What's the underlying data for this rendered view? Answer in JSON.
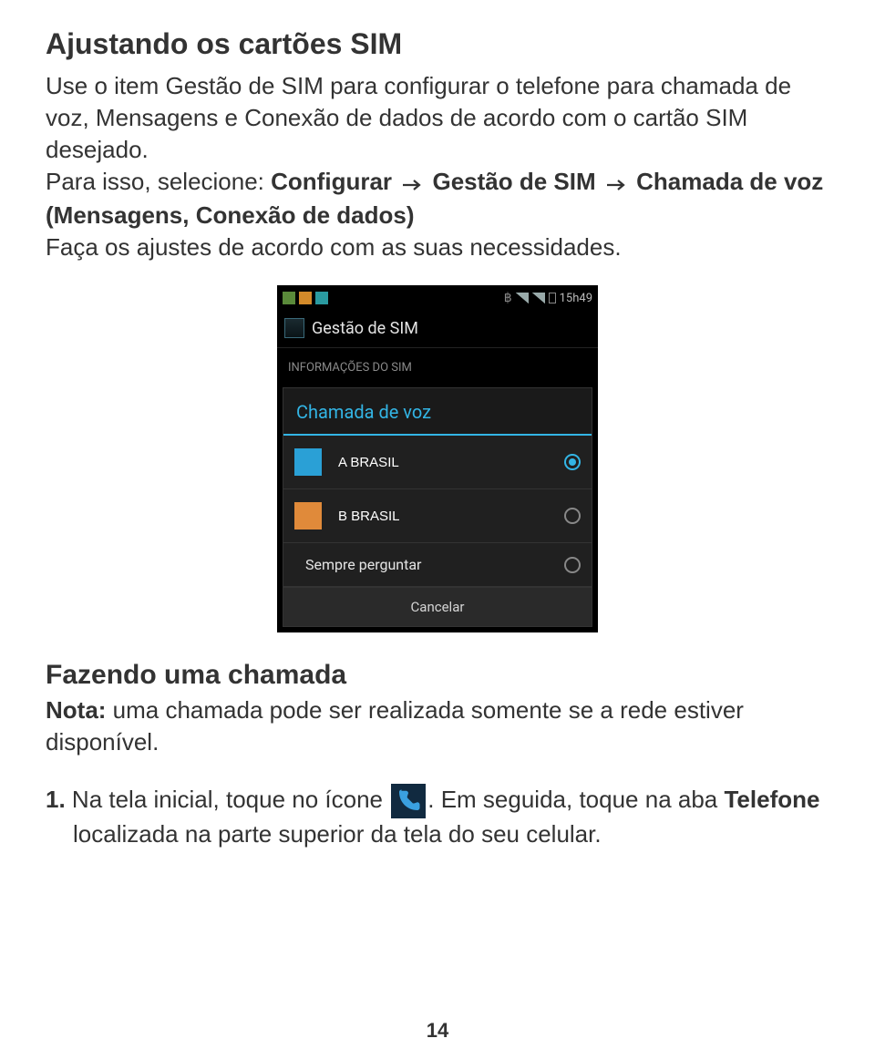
{
  "page_number": "14",
  "section1": {
    "title": "Ajustando os cartões SIM",
    "p1_a": "Use o item Gestão de SIM para configurar o telefone para chamada de voz, Mensagens e Conexão de dados de acordo com o cartão SIM desejado.",
    "p2_a": "Para isso, selecione: ",
    "p2_b": "Configurar",
    "p2_c": "Gestão de SIM",
    "p2_d": "Chamada de voz (Mensagens, Conexão de dados)",
    "p3": "Faça os ajustes de acordo com as suas necessidades."
  },
  "phone": {
    "status_time": "15h49",
    "app_title": "Gestão de SIM",
    "section_label": "INFORMAÇÕES DO SIM",
    "dialog_title": "Chamada de voz",
    "rows": [
      {
        "label": "A BRASIL",
        "square_class": "blue",
        "selected": true
      },
      {
        "label": "B BRASIL",
        "square_class": "orange",
        "selected": false
      },
      {
        "label": "Sempre perguntar",
        "square_class": "",
        "selected": false
      }
    ],
    "cancel": "Cancelar"
  },
  "section2": {
    "title": "Fazendo uma chamada",
    "note_label": "Nota:",
    "note_body": " uma chamada pode ser realizada somente se a rede estiver disponível.",
    "step1_num": "1.",
    "step1_a": " Na tela inicial, toque no ícone ",
    "step1_b": ". Em seguida, toque na aba ",
    "step1_c": "Telefone",
    "step1_d": " localizada na parte superior da tela do seu celular."
  }
}
